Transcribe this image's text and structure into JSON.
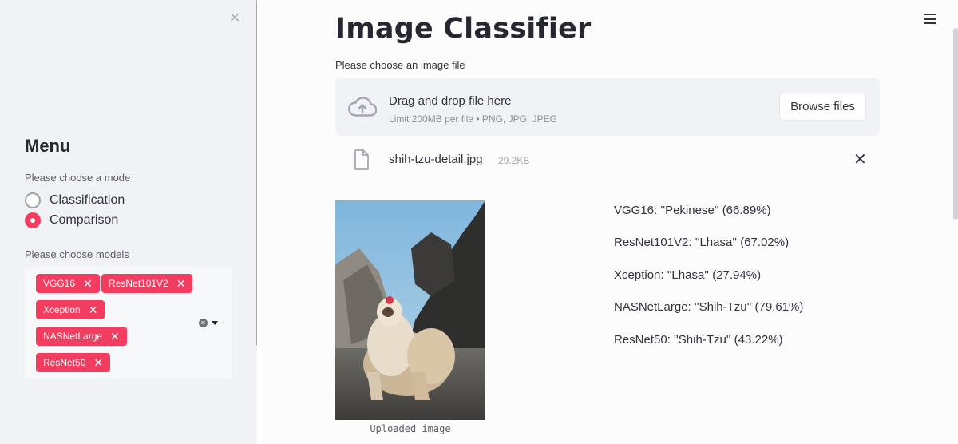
{
  "sidebar": {
    "close_label": "×",
    "menu_title": "Menu",
    "mode_label": "Please choose a mode",
    "modes": [
      {
        "label": "Classification",
        "selected": false
      },
      {
        "label": "Comparison",
        "selected": true
      }
    ],
    "models_label": "Please choose models",
    "models": [
      "VGG16",
      "ResNet101V2",
      "Xception",
      "NASNetLarge",
      "ResNet50"
    ],
    "tag_remove": "✕"
  },
  "main": {
    "title": "Image Classifier",
    "uploader": {
      "label": "Please choose an image file",
      "drop_title": "Drag and drop file here",
      "drop_sub": "Limit 200MB per file • PNG, JPG, JPEG",
      "browse_label": "Browse files"
    },
    "file": {
      "name": "shih-tzu-detail.jpg",
      "size": "29.2KB",
      "remove": "✕"
    },
    "image_caption": "Uploaded image",
    "results": [
      "VGG16: ''Pekinese'' (66.89%)",
      "ResNet101V2: ''Lhasa'' (67.02%)",
      "Xception: ''Lhasa'' (27.94%)",
      "NASNetLarge: ''Shih-Tzu'' (79.61%)",
      "ResNet50: ''Shih-Tzu'' (43.22%)"
    ]
  },
  "colors": {
    "accent": "#f23c60",
    "sidebar_bg": "#f0f2f6",
    "text": "#262730"
  }
}
